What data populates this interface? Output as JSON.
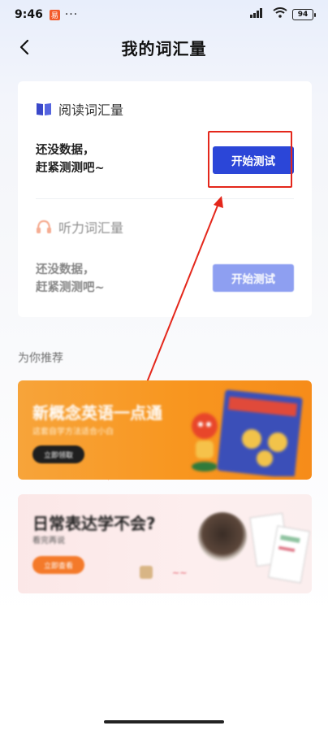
{
  "status_bar": {
    "time": "9:46",
    "app_icon_letter": "易",
    "dots": "···",
    "signal": "HD",
    "battery": "94"
  },
  "header": {
    "back_icon": "chevron-left-icon",
    "title": "我的词汇量"
  },
  "reading_section": {
    "icon": "book-icon",
    "title": "阅读词汇量",
    "empty_text_line1": "还没数据，",
    "empty_text_line2": "赶紧测测吧~",
    "start_button": "开始测试"
  },
  "listening_section": {
    "icon": "headphones-icon",
    "title": "听力词汇量",
    "empty_text_line1": "还没数据，",
    "empty_text_line2": "赶紧测测吧~",
    "start_button": "开始测试"
  },
  "recommend": {
    "heading": "为你推荐",
    "banners": [
      {
        "title": "新概念英语一点通",
        "subtitle": "这套自学方法适合小白",
        "button": "立即领取",
        "bg_color": "#f89a22"
      },
      {
        "title": "日常表达学不会?",
        "subtitle": "看完再说",
        "button": "立即查看",
        "bg_color": "#fbe9e9"
      }
    ]
  },
  "colors": {
    "accent": "#2b46d8",
    "highlight": "#e4271b",
    "orange_banner": "#f89a22"
  }
}
